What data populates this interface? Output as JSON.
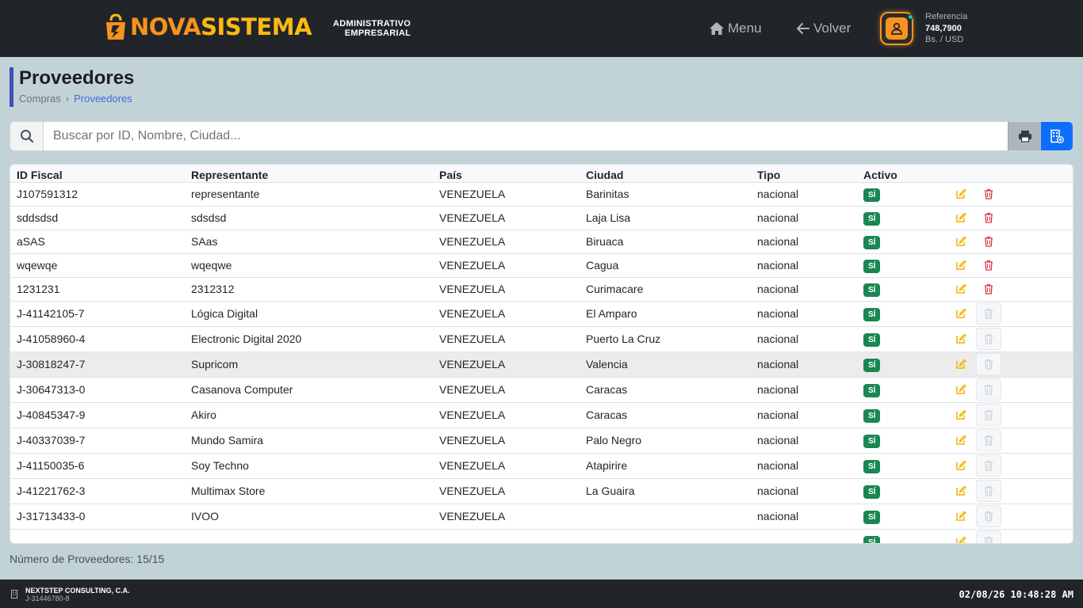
{
  "header": {
    "brand_part1": "NOVA",
    "brand_part2": "SISTEMA",
    "tagline_line1": "ADMINISTRATIVO",
    "tagline_line2": "EMPRESARIAL",
    "nav": {
      "menu_label": "Menu",
      "back_label": "Volver"
    },
    "reference": {
      "label": "Referencia",
      "value": "748,7900",
      "unit": "Bs. / USD"
    },
    "colors": {
      "brand_orange": "#f7931e",
      "brand_yellow": "#fdb913",
      "bar": "#212529"
    }
  },
  "page": {
    "title": "Proveedores",
    "breadcrumb": {
      "parent": "Compras",
      "separator": "›",
      "current": "Proveedores"
    }
  },
  "search": {
    "placeholder": "Buscar por ID, Nombre, Ciudad...",
    "value": ""
  },
  "table": {
    "columns": [
      "ID Fiscal",
      "Representante",
      "País",
      "Ciudad",
      "Tipo",
      "Activo"
    ],
    "rows": [
      {
        "id": "J107591312",
        "rep": "representante",
        "pais": "VENEZUELA",
        "ciudad": "Barinitas",
        "tipo": "nacional",
        "activo": "SÍ",
        "deletable": true
      },
      {
        "id": "sddsdsd",
        "rep": "sdsdsd",
        "pais": "VENEZUELA",
        "ciudad": "Laja Lisa",
        "tipo": "nacional",
        "activo": "SÍ",
        "deletable": true
      },
      {
        "id": "aSAS",
        "rep": "SAas",
        "pais": "VENEZUELA",
        "ciudad": "Biruaca",
        "tipo": "nacional",
        "activo": "SÍ",
        "deletable": true
      },
      {
        "id": "wqewqe",
        "rep": "wqeqwe",
        "pais": "VENEZUELA",
        "ciudad": "Cagua",
        "tipo": "nacional",
        "activo": "SÍ",
        "deletable": true
      },
      {
        "id": "1231231",
        "rep": "2312312",
        "pais": "VENEZUELA",
        "ciudad": "Curimacare",
        "tipo": "nacional",
        "activo": "SÍ",
        "deletable": true
      },
      {
        "id": "J-41142105-7",
        "rep": "Lógica Digital",
        "pais": "VENEZUELA",
        "ciudad": "El Amparo",
        "tipo": "nacional",
        "activo": "SÍ",
        "deletable": false
      },
      {
        "id": "J-41058960-4",
        "rep": "Electronic Digital 2020",
        "pais": "VENEZUELA",
        "ciudad": "Puerto La Cruz",
        "tipo": "nacional",
        "activo": "SÍ",
        "deletable": false
      },
      {
        "id": "J-30818247-7",
        "rep": "Supricom",
        "pais": "VENEZUELA",
        "ciudad": "Valencia",
        "tipo": "nacional",
        "activo": "SÍ",
        "deletable": false,
        "highlight": true
      },
      {
        "id": "J-30647313-0",
        "rep": "Casanova Computer",
        "pais": "VENEZUELA",
        "ciudad": "Caracas",
        "tipo": "nacional",
        "activo": "SÍ",
        "deletable": false
      },
      {
        "id": "J-40845347-9",
        "rep": "Akiro",
        "pais": "VENEZUELA",
        "ciudad": "Caracas",
        "tipo": "nacional",
        "activo": "SÍ",
        "deletable": false
      },
      {
        "id": "J-40337039-7",
        "rep": "Mundo Samira",
        "pais": "VENEZUELA",
        "ciudad": "Palo Negro",
        "tipo": "nacional",
        "activo": "SÍ",
        "deletable": false
      },
      {
        "id": "J-41150035-6",
        "rep": "Soy Techno",
        "pais": "VENEZUELA",
        "ciudad": "Atapirire",
        "tipo": "nacional",
        "activo": "SÍ",
        "deletable": false
      },
      {
        "id": "J-41221762-3",
        "rep": "Multimax Store",
        "pais": "VENEZUELA",
        "ciudad": "La Guaira",
        "tipo": "nacional",
        "activo": "SÍ",
        "deletable": false
      },
      {
        "id": "J-31713433-0",
        "rep": "IVOO",
        "pais": "VENEZUELA",
        "ciudad": "",
        "tipo": "nacional",
        "activo": "SÍ",
        "deletable": false
      },
      {
        "id": "",
        "rep": "",
        "pais": "",
        "ciudad": "",
        "tipo": "",
        "activo": "SÍ",
        "deletable": false,
        "partial": true
      }
    ]
  },
  "footer_count": {
    "label": "Número de Proveedores: 15/15"
  },
  "footer": {
    "company_name": "NEXTSTEP CONSULTING, C.A.",
    "company_id": "J-31446780-8",
    "datetime": "02/08/26 10:48:28 AM"
  }
}
